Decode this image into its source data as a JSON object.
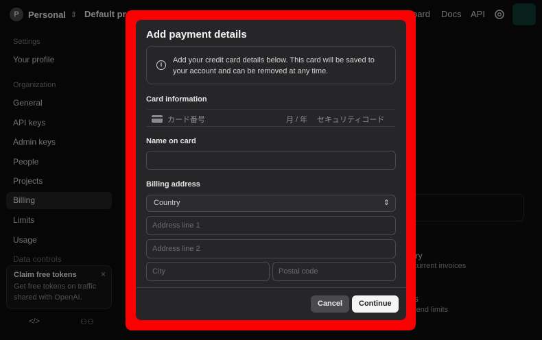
{
  "topbar": {
    "org_initial": "P",
    "org_name": "Personal",
    "separator": "/",
    "project": "Default proje",
    "nav": [
      "oard",
      "Docs",
      "API"
    ]
  },
  "sidebar": {
    "settings_heading": "Settings",
    "your_profile": "Your profile",
    "org_heading": "Organization",
    "items": [
      "General",
      "API keys",
      "Admin keys",
      "People",
      "Projects",
      "Billing",
      "Limits",
      "Usage",
      "Data controls"
    ],
    "active_item": "Billing",
    "claim": {
      "title": "Claim free tokens",
      "body": "Get free tokens on traffic shared with OpenAI.",
      "close": "×"
    }
  },
  "background": {
    "history_title": "ary",
    "history_desc": "d current invoices",
    "limits_title": "s",
    "limits_desc": "spend limits"
  },
  "modal": {
    "title": "Add payment details",
    "notice": "Add your credit card details below. This card will be saved to your account and can be removed at any time.",
    "card_label": "Card information",
    "card_number_placeholder": "カード番号",
    "card_expiry_placeholder": "月 / 年",
    "card_cvc_placeholder": "セキュリティコード",
    "name_label": "Name on card",
    "name_value": "",
    "billing_label": "Billing address",
    "country_value": "Country",
    "address1_placeholder": "Address line 1",
    "address2_placeholder": "Address line 2",
    "city_placeholder": "City",
    "postal_placeholder": "Postal code",
    "cancel_label": "Cancel",
    "continue_label": "Continue"
  },
  "colors": {
    "highlight": "#fb0000",
    "modal_bg": "#262628",
    "page_bg": "#0b0b0c"
  }
}
